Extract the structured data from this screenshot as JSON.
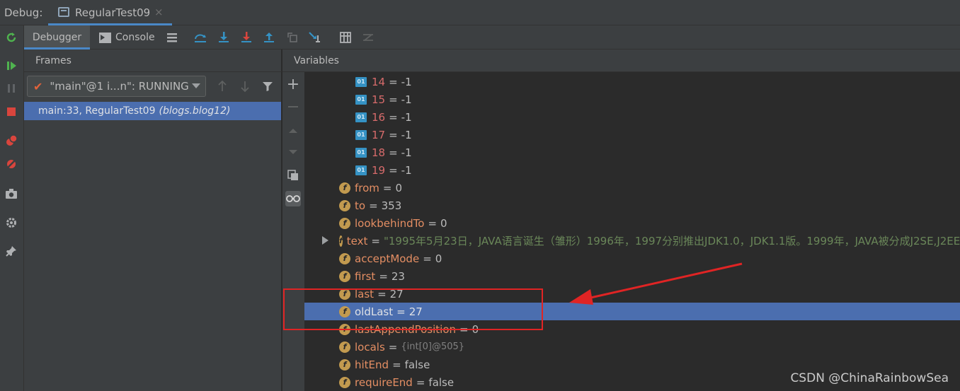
{
  "topbar": {
    "debug_label": "Debug:",
    "run_tab_label": "RegularTest09",
    "close_glyph": "×"
  },
  "tabs": {
    "debugger": "Debugger",
    "console": "Console"
  },
  "frames": {
    "title": "Frames",
    "thread_select_value": "\"main\"@1 i...n\": RUNNING",
    "frame_location": "main:33, RegularTest09",
    "frame_package": "(blogs.blog12)"
  },
  "variables": {
    "title": "Variables",
    "rows": [
      {
        "kind": "index",
        "name": "14",
        "value": "-1"
      },
      {
        "kind": "index",
        "name": "15",
        "value": "-1"
      },
      {
        "kind": "index",
        "name": "16",
        "value": "-1"
      },
      {
        "kind": "index",
        "name": "17",
        "value": "-1"
      },
      {
        "kind": "index",
        "name": "18",
        "value": "-1"
      },
      {
        "kind": "index",
        "name": "19",
        "value": "-1"
      },
      {
        "kind": "field",
        "name": "from",
        "value": "0"
      },
      {
        "kind": "field",
        "name": "to",
        "value": "353"
      },
      {
        "kind": "field",
        "name": "lookbehindTo",
        "value": "0"
      },
      {
        "kind": "field",
        "name": "text",
        "value": "\"1995年5月23日，JAVA语言诞生（雏形）1996年，1997分别推出JDK1.0，JDK1.1版。1999年，JAVA被分成J2SE,J2EE",
        "expandable": true,
        "string": true
      },
      {
        "kind": "field",
        "name": "acceptMode",
        "value": "0"
      },
      {
        "kind": "field",
        "name": "first",
        "value": "23"
      },
      {
        "kind": "field",
        "name": "last",
        "value": "27"
      },
      {
        "kind": "field",
        "name": "oldLast",
        "value": "27",
        "selected": true
      },
      {
        "kind": "field",
        "name": "lastAppendPosition",
        "value": "0"
      },
      {
        "kind": "field",
        "name": "locals",
        "value": "{int[0]@505}",
        "ref": true
      },
      {
        "kind": "field",
        "name": "hitEnd",
        "value": "false"
      },
      {
        "kind": "field",
        "name": "requireEnd",
        "value": "false"
      }
    ],
    "index_icon_text": "01",
    "field_icon_text": "f"
  },
  "watermark": "CSDN @ChinaRainbowSea",
  "colors": {
    "accent": "#4a88c7",
    "selection": "#4b6eaf",
    "annotation": "#e02424",
    "index_name": "#d76b6b",
    "string_value": "#6a8759"
  },
  "icons": {
    "left_toolbar": [
      "rerun-icon",
      "resume-icon",
      "pause-icon",
      "stop-icon",
      "view-breakpoints-icon",
      "mute-breakpoints-icon",
      "camera-icon",
      "settings-icon",
      "pin-icon"
    ],
    "debug_toolbar": [
      "show-execution-point-icon",
      "step-over-icon",
      "step-into-icon",
      "force-step-into-icon",
      "step-out-icon",
      "drop-frame-icon",
      "run-to-cursor-icon",
      "evaluate-expression-icon",
      "trace-icon"
    ]
  }
}
